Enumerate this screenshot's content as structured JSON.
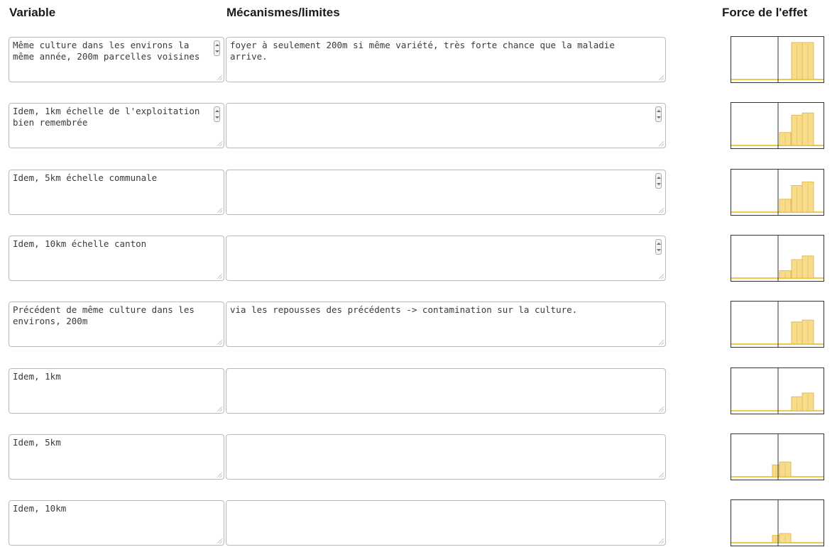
{
  "headers": {
    "variable": "Variable",
    "mecanismes": "Mécanismes/limites",
    "force": "Force de l'effet"
  },
  "colors": {
    "bar_fill": "#f7dc8d",
    "bar_stroke": "#e6bb4a",
    "baseline": "#f0c850",
    "axis": "#333333",
    "textarea_border": "#b9b9b9"
  },
  "rows": [
    {
      "variable": "Même culture dans les environs la même année, 200m parcelles voisines",
      "mecanismes": "foyer à seulement 200m si même variété, très forte chance que la maladie arrive.",
      "var_spinner": true,
      "mec_spinner": false,
      "force_bars": [
        0,
        0,
        1.0,
        1.0
      ]
    },
    {
      "variable": "Idem, 1km échelle de l'exploitation bien remembrée",
      "mecanismes": "",
      "var_spinner": true,
      "mec_spinner": true,
      "force_bars": [
        0,
        0.35,
        0.82,
        0.88
      ]
    },
    {
      "variable": "Idem, 5km échelle communale",
      "mecanismes": "",
      "var_spinner": false,
      "mec_spinner": true,
      "force_bars": [
        0,
        0.35,
        0.72,
        0.82
      ]
    },
    {
      "variable": "Idem, 10km échelle canton",
      "mecanismes": "",
      "var_spinner": false,
      "mec_spinner": true,
      "force_bars": [
        0,
        0.2,
        0.5,
        0.6
      ]
    },
    {
      "variable": "Précédent de même culture dans les environs, 200m",
      "mecanismes": "via les repousses des précédents -> contamination sur la culture.",
      "var_spinner": false,
      "mec_spinner": false,
      "force_bars": [
        0,
        0,
        0.6,
        0.65
      ]
    },
    {
      "variable": "Idem, 1km",
      "mecanismes": "",
      "var_spinner": false,
      "mec_spinner": false,
      "force_bars": [
        0,
        0,
        0.38,
        0.48
      ]
    },
    {
      "variable": "Idem, 5km",
      "mecanismes": "",
      "var_spinner": false,
      "mec_spinner": false,
      "force_bars": [
        0.32,
        0.4,
        0,
        0
      ]
    },
    {
      "variable": "Idem, 10km",
      "mecanismes": "",
      "var_spinner": false,
      "mec_spinner": false,
      "force_bars": [
        0.2,
        0.25,
        0,
        0
      ]
    }
  ]
}
